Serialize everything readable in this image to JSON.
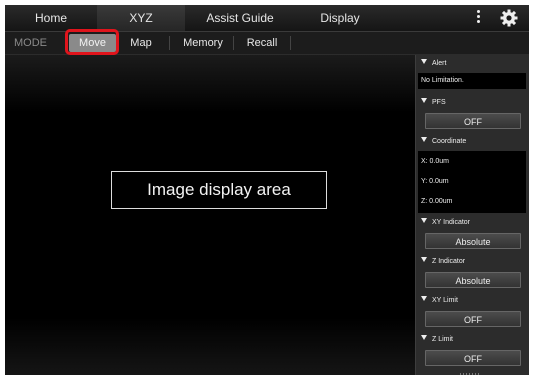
{
  "topnav": {
    "tabs": [
      {
        "label": "Home"
      },
      {
        "label": "XYZ"
      },
      {
        "label": "Assist Guide"
      },
      {
        "label": "Display"
      }
    ],
    "active_tab": "XYZ"
  },
  "modebar": {
    "label": "MODE",
    "buttons": [
      {
        "label": "Move"
      },
      {
        "label": "Map"
      },
      {
        "label": "Memory"
      },
      {
        "label": "Recall"
      }
    ],
    "selected": "Move",
    "highlight_color": "#e0141c"
  },
  "image_area": {
    "label": "Image display area"
  },
  "panel": {
    "alert": {
      "title": "Alert",
      "text": "No Limitation."
    },
    "pfs": {
      "title": "PFS",
      "value": "OFF"
    },
    "coordinate": {
      "title": "Coordinate",
      "x": "X: 0.0um",
      "y": "Y: 0.0um",
      "z": "Z: 0.00um"
    },
    "xy_indicator": {
      "title": "XY Indicator",
      "value": "Absolute"
    },
    "z_indicator": {
      "title": "Z Indicator",
      "value": "Absolute"
    },
    "xy_limit": {
      "title": "XY Limit",
      "value": "OFF"
    },
    "z_limit": {
      "title": "Z Limit",
      "value": "OFF"
    }
  },
  "icons": {
    "menu": "more-vertical-icon",
    "settings": "gear-icon",
    "section": "triangle-down-icon"
  }
}
